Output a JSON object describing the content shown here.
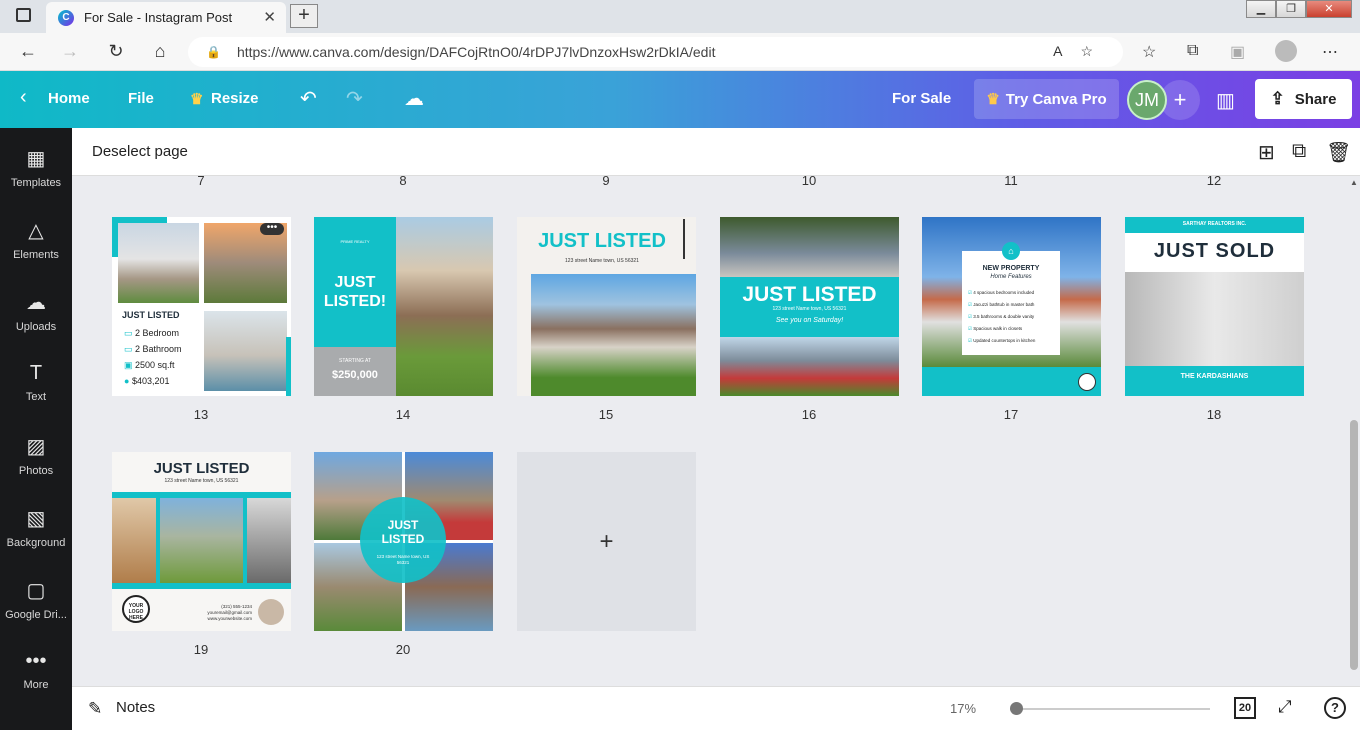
{
  "browser": {
    "tab_title": "For Sale - Instagram Post",
    "url": "https://www.canva.com/design/DAFCojRtnO0/4rDPJ7lvDnzoxHsw2rDkIA/edit"
  },
  "topbar": {
    "home": "Home",
    "file": "File",
    "resize": "Resize",
    "design_title": "For Sale",
    "try_pro": "Try Canva Pro",
    "avatar_initials": "JM",
    "share": "Share"
  },
  "sidebar": {
    "items": [
      {
        "label": "Templates",
        "icon": "templates-icon"
      },
      {
        "label": "Elements",
        "icon": "elements-icon"
      },
      {
        "label": "Uploads",
        "icon": "uploads-icon"
      },
      {
        "label": "Text",
        "icon": "text-icon"
      },
      {
        "label": "Photos",
        "icon": "photos-icon"
      },
      {
        "label": "Background",
        "icon": "background-icon"
      },
      {
        "label": "Google Dri...",
        "icon": "google-drive-icon"
      },
      {
        "label": "More",
        "icon": "more-icon"
      }
    ]
  },
  "pagebar": {
    "deselect": "Deselect page"
  },
  "page_numbers_top": [
    "7",
    "8",
    "9",
    "10",
    "11",
    "12"
  ],
  "pages": {
    "p13": {
      "number": "13",
      "title": "JUST LISTED",
      "features": [
        "2 Bedroom",
        "2 Bathroom",
        "2500 sq.ft",
        "$403,201"
      ]
    },
    "p14": {
      "number": "14",
      "brand": "PRIME REALTY",
      "title": "JUST LISTED!",
      "starting": "STARTING AT",
      "price": "$250,000"
    },
    "p15": {
      "number": "15",
      "title": "JUST LISTED",
      "address": "123 street Name town, US 56321"
    },
    "p16": {
      "number": "16",
      "title": "JUST LISTED",
      "address": "123 street Name town, US 56321",
      "tagline": "See you on Saturday!"
    },
    "p17": {
      "number": "17",
      "title": "NEW PROPERTY",
      "subtitle": "Home Features",
      "features": [
        "4 spacious bedrooms included",
        "Jacuzzi bathtub in master bath",
        "3.5 bathrooms & double vanity",
        "Spacious walk in closets",
        "Updated countertops in kitchen"
      ]
    },
    "p18": {
      "number": "18",
      "brand": "SARTHAY REALTORS INC.",
      "title": "JUST SOLD",
      "footer": "THE KARDASHIANS"
    },
    "p19": {
      "number": "19",
      "title": "JUST LISTED",
      "address": "123 street Name town, US 56321",
      "logo": "YOUR LOGO HERE",
      "phone": "(321) 555-1234",
      "email": "youremail@gmail.com",
      "site": "www.yourwebsite.com"
    },
    "p20": {
      "number": "20",
      "title": "JUST LISTED",
      "address": "123 street Name town, US 56321"
    }
  },
  "add_page": "+",
  "bottombar": {
    "notes": "Notes",
    "zoom": "17%",
    "page_count": "20"
  },
  "colors": {
    "teal": "#12c0c8",
    "sidebar": "#18191b",
    "canvas_bg": "#ebecf0"
  }
}
